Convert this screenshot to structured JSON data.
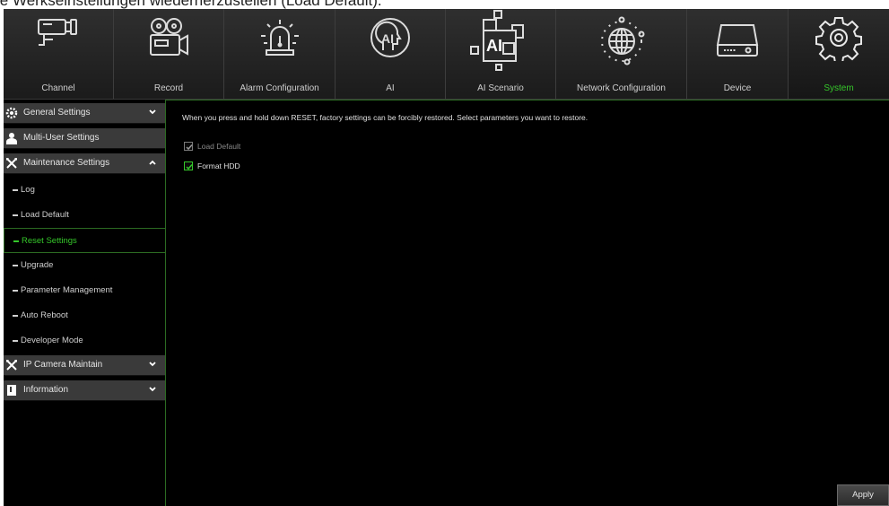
{
  "caption": "ie Werkseinstellungen wiederherzustellen (Load Default).",
  "topnav": {
    "tabs": [
      {
        "label": "Channel",
        "icon": "camera-icon"
      },
      {
        "label": "Record",
        "icon": "film-projector-icon"
      },
      {
        "label": "Alarm Configuration",
        "icon": "alarm-siren-icon"
      },
      {
        "label": "AI",
        "icon": "ai-head-icon"
      },
      {
        "label": "AI Scenario",
        "icon": "ai-scenario-icon"
      },
      {
        "label": "Network Configuration",
        "icon": "globe-network-icon"
      },
      {
        "label": "Device",
        "icon": "hdd-device-icon"
      },
      {
        "label": "System",
        "icon": "gear-icon",
        "active": true
      }
    ]
  },
  "sidebar": {
    "groups": [
      {
        "label": "General Settings",
        "icon": "gear-icon",
        "expanded": false
      },
      {
        "label": "Multi-User Settings",
        "icon": "user-icon",
        "expanded": false
      },
      {
        "label": "Maintenance Settings",
        "icon": "tools-icon",
        "expanded": true
      },
      {
        "label": "IP Camera Maintain",
        "icon": "tools-icon",
        "expanded": false
      },
      {
        "label": "Information",
        "icon": "info-icon",
        "expanded": false
      }
    ],
    "maintenance_items": [
      {
        "label": "Log"
      },
      {
        "label": "Load Default"
      },
      {
        "label": "Reset Settings",
        "active": true
      },
      {
        "label": "Upgrade"
      },
      {
        "label": "Parameter Management"
      },
      {
        "label": "Auto Reboot"
      },
      {
        "label": "Developer Mode"
      }
    ]
  },
  "content": {
    "description": "When you press and hold down RESET, factory settings can be forcibly restored. Select parameters you want to restore.",
    "options": [
      {
        "label": "Load Default",
        "checked": true,
        "disabled": true
      },
      {
        "label": "Format HDD",
        "checked": true,
        "disabled": false
      }
    ],
    "apply_label": "Apply"
  },
  "colors": {
    "accent": "#35c72a",
    "background": "#000000",
    "panel": "#3a3a3a"
  }
}
